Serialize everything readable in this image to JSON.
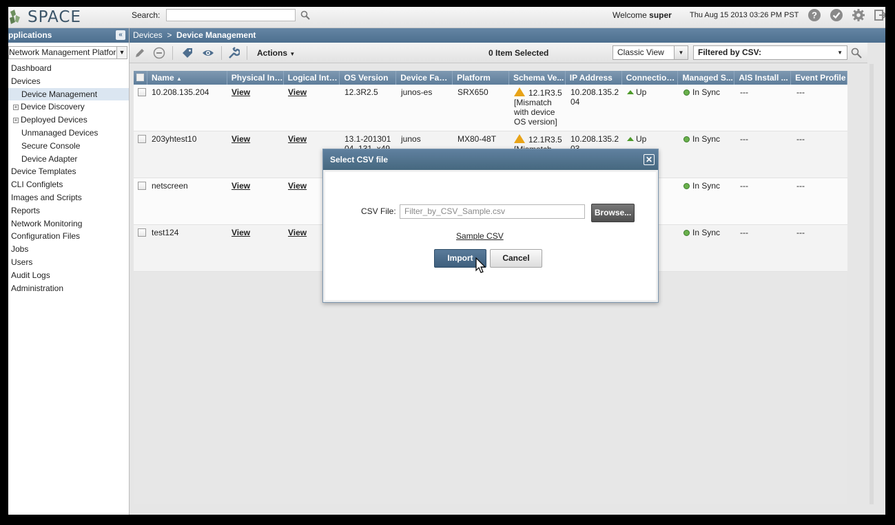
{
  "topbar": {
    "logo_text": "SPACE",
    "search_label": "Search:",
    "search_value": "",
    "welcome_prefix": "Welcome",
    "user": "super",
    "datetime": "Thu Aug 15 2013 03:26 PM PST",
    "icons": [
      "help-icon",
      "jobs-check-icon",
      "settings-gear-icon",
      "logout-icon"
    ]
  },
  "sidebar": {
    "header": "pplications",
    "app_selector": "Network Management Platform",
    "items": [
      {
        "label": "Dashboard",
        "level": 0
      },
      {
        "label": "Devices",
        "level": 0
      },
      {
        "label": "Device Management",
        "level": 1,
        "selected": true
      },
      {
        "label": "Device Discovery",
        "level": 1,
        "expandable": true
      },
      {
        "label": "Deployed Devices",
        "level": 1,
        "expandable": true
      },
      {
        "label": "Unmanaged Devices",
        "level": 1
      },
      {
        "label": "Secure Console",
        "level": 1
      },
      {
        "label": "Device Adapter",
        "level": 1
      },
      {
        "label": "Device Templates",
        "level": 0
      },
      {
        "label": "CLI Configlets",
        "level": 0
      },
      {
        "label": "Images and Scripts",
        "level": 0
      },
      {
        "label": "Reports",
        "level": 0
      },
      {
        "label": "Network Monitoring",
        "level": 0
      },
      {
        "label": "Configuration Files",
        "level": 0
      },
      {
        "label": "Jobs",
        "level": 0
      },
      {
        "label": "Users",
        "level": 0
      },
      {
        "label": "Audit Logs",
        "level": 0
      },
      {
        "label": "Administration",
        "level": 0
      }
    ]
  },
  "breadcrumb": {
    "root": "Devices",
    "sep": ">",
    "current": "Device Management"
  },
  "toolbar": {
    "actions_label": "Actions",
    "selected_count": "0 Item Selected",
    "view_select": "Classic View",
    "filter_select": "Filtered by CSV:"
  },
  "grid": {
    "columns": [
      "Name",
      "Physical Int...",
      "Logical Inte...",
      "OS Version",
      "Device Family",
      "Platform",
      "Schema Ve...",
      "IP Address",
      "Connection...",
      "Managed S...",
      "AIS Install ...",
      "Event Profile"
    ],
    "rows": [
      {
        "name": "10.208.135.204",
        "physical": "View",
        "logical": "View",
        "os": "12.3R2.5",
        "family": "junos-es",
        "platform": "SRX650",
        "schema": "12.1R3.5 [Mismatch with device OS version]",
        "ip": "10.208.135.204",
        "connection": "Up",
        "managed": "In Sync",
        "ais": "---",
        "event": "---"
      },
      {
        "name": "203yhtest10",
        "physical": "View",
        "logical": "View",
        "os": "13.1-20130104_131_x49.",
        "family": "junos",
        "platform": "MX80-48T",
        "schema": "12.1R3.5 [Mismatch",
        "ip": "10.208.135.203",
        "connection": "Up",
        "managed": "In Sync",
        "ais": "---",
        "event": "---"
      },
      {
        "name": "netscreen",
        "physical": "View",
        "logical": "View",
        "managed": "In Sync",
        "ais": "---",
        "event": "---"
      },
      {
        "name": "test124",
        "physical": "View",
        "logical": "View",
        "managed": "In Sync",
        "ais": "---",
        "event": "---"
      }
    ]
  },
  "dialog": {
    "title": "Select CSV file",
    "csv_label": "CSV File:",
    "csv_value": "Filter_by_CSV_Sample.csv",
    "browse": "Browse...",
    "sample_link": "Sample CSV",
    "import": "Import",
    "cancel": "Cancel"
  },
  "colors": {
    "header_blue": "#4d6f8f",
    "status_green": "#4e9a2a",
    "warning_amber": "#e8a317"
  }
}
